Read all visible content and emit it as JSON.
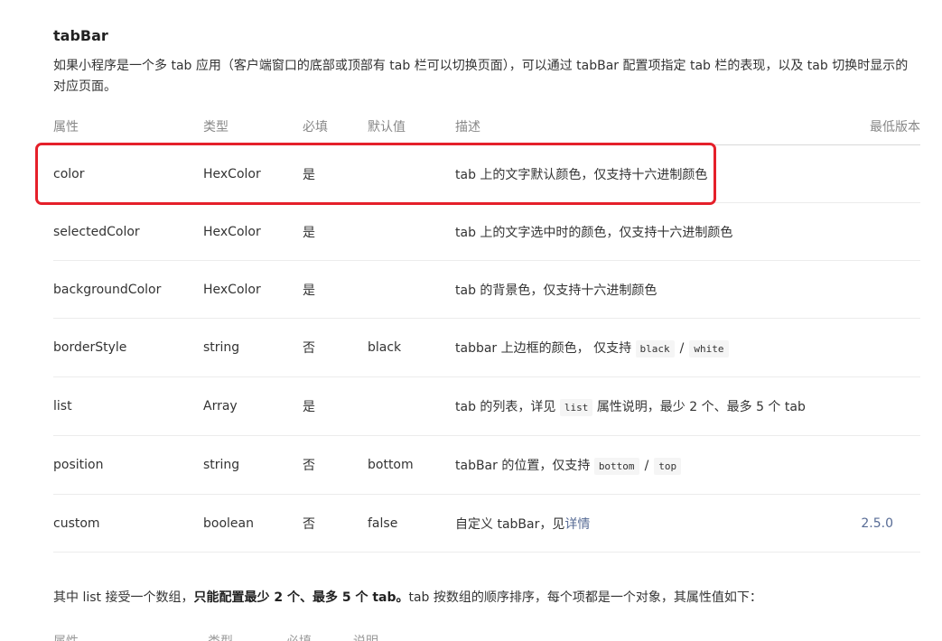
{
  "section": {
    "title": "tabBar",
    "intro": "如果小程序是一个多 tab 应用（客户端窗口的底部或顶部有 tab 栏可以切换页面），可以通过 tabBar 配置项指定 tab 栏的表现，以及 tab 切换时显示的对应页面。"
  },
  "table": {
    "headers": [
      "属性",
      "类型",
      "必填",
      "默认值",
      "描述",
      "最低版本"
    ],
    "rows": [
      {
        "prop": "color",
        "type": "HexColor",
        "required": "是",
        "default": "",
        "desc": "tab 上的文字默认颜色，仅支持十六进制颜色",
        "version": ""
      },
      {
        "prop": "selectedColor",
        "type": "HexColor",
        "required": "是",
        "default": "",
        "desc": "tab 上的文字选中时的颜色，仅支持十六进制颜色",
        "version": ""
      },
      {
        "prop": "backgroundColor",
        "type": "HexColor",
        "required": "是",
        "default": "",
        "desc": "tab 的背景色，仅支持十六进制颜色",
        "version": ""
      },
      {
        "prop": "borderStyle",
        "type": "string",
        "required": "否",
        "default": "black",
        "desc_pre": "tabbar 上边框的颜色， 仅支持",
        "code1": "black",
        "sep": "/",
        "code2": "white",
        "version": ""
      },
      {
        "prop": "list",
        "type": "Array",
        "required": "是",
        "default": "",
        "desc_pre": "tab 的列表，详见",
        "code1": "list",
        "desc_post": "属性说明，最少 2 个、最多 5 个 tab",
        "version": ""
      },
      {
        "prop": "position",
        "type": "string",
        "required": "否",
        "default": "bottom",
        "desc_pre": "tabBar 的位置，仅支持",
        "code1": "bottom",
        "sep": "/",
        "code2": "top",
        "version": ""
      },
      {
        "prop": "custom",
        "type": "boolean",
        "required": "否",
        "default": "false",
        "desc_pre": "自定义 tabBar，见",
        "link": "详情",
        "version": "2.5.0"
      }
    ]
  },
  "after": {
    "pre": "其中 list 接受一个数组，",
    "bold": "只能配置最少 2 个、最多 5 个 tab。",
    "post": "tab 按数组的顺序排序，每个项都是一个对象，其属性值如下："
  },
  "subtable_headers": [
    "属性",
    "类型",
    "必填",
    "说明"
  ],
  "colors": {
    "highlight": "#e5202a",
    "link": "#576b95"
  }
}
